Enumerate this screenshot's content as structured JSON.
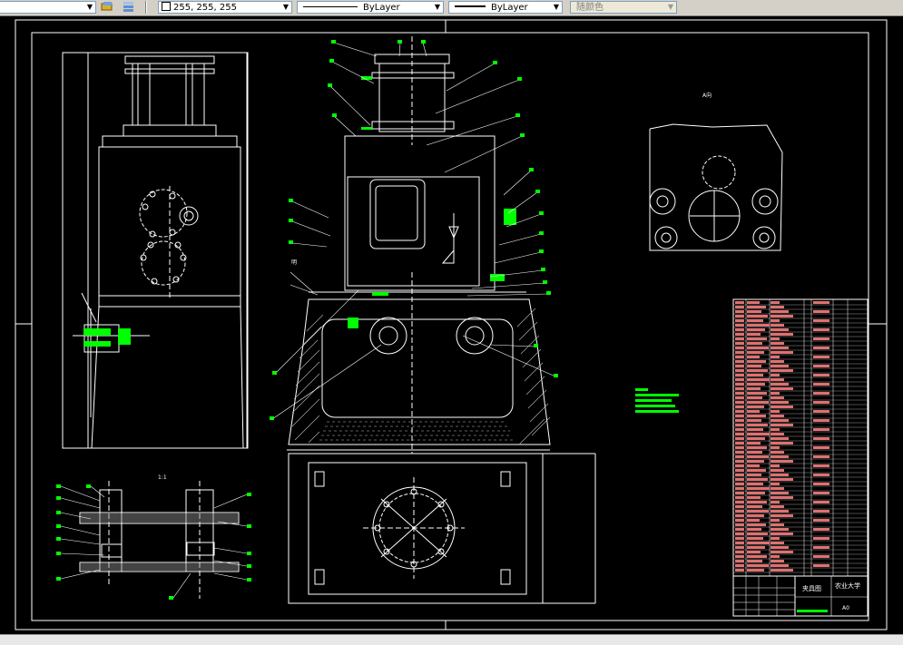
{
  "toolbar": {
    "color_value": "255, 255, 255",
    "linetype_value": "ByLayer",
    "lineweight_value": "ByLayer",
    "plotstyle_value": "随颜色"
  },
  "drawing": {
    "title_block": {
      "university": "农业大学",
      "drawing_name": "夹具图",
      "sheet_no": "A0"
    },
    "notes": {
      "section_label": "1:1",
      "view_label": "A向",
      "side_label": "明"
    }
  },
  "colors": {
    "accent": "#00ff00",
    "table_fill": "#e07070",
    "line": "#ffffff"
  }
}
